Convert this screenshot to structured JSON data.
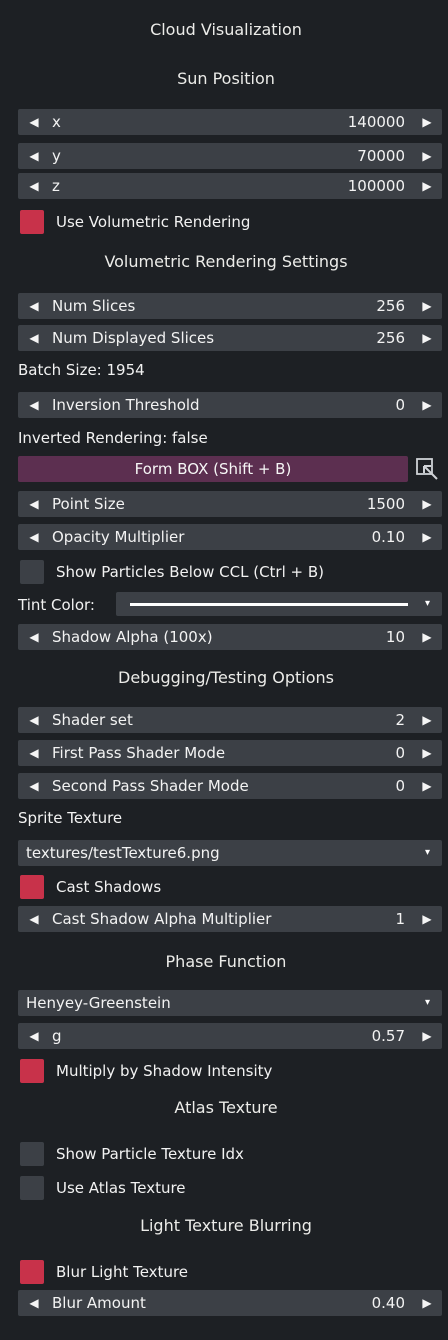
{
  "title": "Cloud Visualization",
  "sections": {
    "sun_position": "Sun Position",
    "volumetric_settings": "Volumetric Rendering Settings",
    "debugging": "Debugging/Testing Options",
    "phase_function": "Phase Function",
    "atlas_texture": "Atlas Texture",
    "light_blurring": "Light Texture Blurring"
  },
  "sun": {
    "x": {
      "label": "x",
      "value": "140000"
    },
    "y": {
      "label": "y",
      "value": "70000"
    },
    "z": {
      "label": "z",
      "value": "100000"
    }
  },
  "use_volumetric": {
    "label": "Use Volumetric Rendering",
    "checked": true
  },
  "num_slices": {
    "label": "Num Slices",
    "value": "256"
  },
  "num_displayed_slices": {
    "label": "Num Displayed Slices",
    "value": "256"
  },
  "batch_size": "Batch Size: 1954",
  "inversion_threshold": {
    "label": "Inversion Threshold",
    "value": "0"
  },
  "inverted_rendering": "Inverted Rendering: false",
  "form_box": "Form BOX (Shift + B)",
  "point_size": {
    "label": "Point Size",
    "value": "1500"
  },
  "opacity_multiplier": {
    "label": "Opacity Multiplier",
    "value": "0.10"
  },
  "show_particles_below_ccl": {
    "label": "Show Particles Below CCL (Ctrl + B)",
    "checked": false
  },
  "tint_color": {
    "label": "Tint Color:",
    "color": "#ffffff"
  },
  "shadow_alpha": {
    "label": "Shadow Alpha (100x)",
    "value": "10"
  },
  "shader_set": {
    "label": "Shader set",
    "value": "2"
  },
  "first_pass_mode": {
    "label": "First Pass Shader Mode",
    "value": "0"
  },
  "second_pass_mode": {
    "label": "Second Pass Shader Mode",
    "value": "0"
  },
  "sprite_texture_label": "Sprite Texture",
  "sprite_texture_value": "textures/testTexture6.png",
  "cast_shadows": {
    "label": "Cast Shadows",
    "checked": true
  },
  "cast_shadow_alpha": {
    "label": "Cast Shadow Alpha Multiplier",
    "value": "1"
  },
  "phase_select": "Henyey-Greenstein",
  "g": {
    "label": "g",
    "value": "0.57"
  },
  "multiply_shadow": {
    "label": "Multiply by Shadow Intensity",
    "checked": true
  },
  "show_particle_idx": {
    "label": "Show Particle Texture Idx",
    "checked": false
  },
  "use_atlas": {
    "label": "Use Atlas Texture",
    "checked": false
  },
  "blur_light": {
    "label": "Blur Light Texture",
    "checked": true
  },
  "blur_amount": {
    "label": "Blur Amount",
    "value": "0.40"
  },
  "colors": {
    "accent": "#c8324a",
    "button": "#5c2f50",
    "widget": "#3c4046",
    "background": "#1d2024"
  },
  "icons": {
    "left": "triangle-left-icon",
    "right": "triangle-right-icon",
    "dropdown": "dropdown-caret-icon",
    "pick": "color-pick-icon"
  }
}
